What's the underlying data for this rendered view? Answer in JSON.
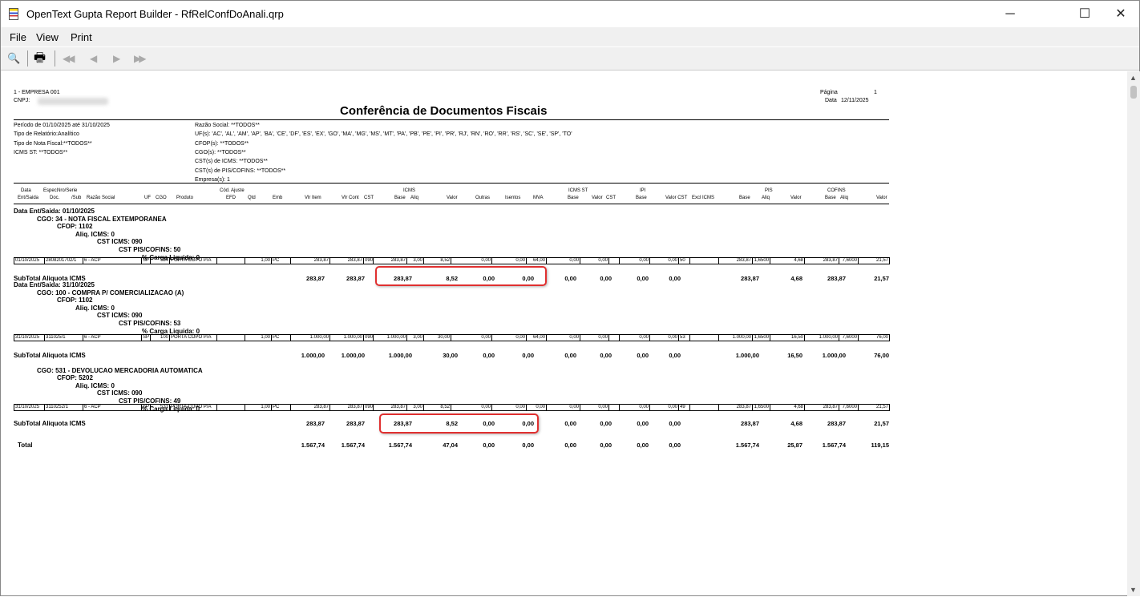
{
  "window": {
    "title": "OpenText Gupta Report Builder - RfRelConfDoAnali.qrp",
    "minimize": "─",
    "maximize": "☐",
    "close": "✕"
  },
  "menu": [
    "File",
    "View",
    "Print"
  ],
  "toolbar": {
    "icons": [
      "print-preview-icon",
      "printer-icon",
      "first-page-icon",
      "previous-page-icon",
      "next-page-icon",
      "last-page-icon"
    ],
    "glyphs": [
      "🔍",
      "🖶",
      "◀◀",
      "◀",
      "▶",
      "▶▶"
    ]
  },
  "report": {
    "company": "1 - EMPRESA 001",
    "cnpj_label": "CNPJ:",
    "page_label": "Página",
    "page": "1",
    "date_label": "Data",
    "date": "12/11/2025",
    "title": "Conferência de Documentos Fiscais",
    "filters_left": [
      "Período de 01/10/2025 até 31/10/2025",
      "Tipo de Relatório:Analítico",
      "Tipo de Nota Fiscal:**TODOS**",
      "ICMS ST: **TODOS**"
    ],
    "filters_right": [
      "Razão Social: **TODOS**",
      "UF(s): 'AC', 'AL', 'AM', 'AP', 'BA', 'CE', 'DF', 'ES', 'EX', 'GO', 'MA', 'MG', 'MS', 'MT', 'PA', 'PB', 'PE', 'PI', 'PR', 'RJ', 'RN', 'RO', 'RR', 'RS', 'SC', 'SE', 'SP', 'TO'",
      "CFOP(s): **TODOS**",
      "CGO(s): **TODOS**",
      "CST(s) de ICMS: **TODOS**",
      "CST(s) de PIS/COFINS: **TODOS**",
      "Empresa(s): 1"
    ],
    "column_groups": [
      "ICMS",
      "ICMS ST",
      "IPI",
      "PIS",
      "COFINS"
    ],
    "column_headers_top": [
      "Data",
      "Espec.",
      "Nro/Serie",
      "Cód. Ajuste"
    ],
    "column_headers": [
      "Ent/Saida",
      "Doc.",
      "/Sub",
      "Razão Social",
      "UF",
      "CGO",
      "Produto",
      "EFD",
      "Qtd",
      "Emb",
      "Vlr Item",
      "Vlr Cont",
      "CST",
      "Base",
      "Aliq",
      "Valor",
      "Outras",
      "Isentos",
      "MVA",
      "Base",
      "Valor",
      "CST",
      "Base",
      "Valor CST",
      "Excl ICMS",
      "Base",
      "Aliq",
      "Valor",
      "Base",
      "Aliq",
      "Valor"
    ],
    "groups": [
      {
        "date_header": "Data Ent/Saida: 01/10/2025",
        "cgo": "CGO: 34 - NOTA FISCAL EXTEMPORANEA",
        "cfop": "CFOP: 1102",
        "aliq": "Aliq. ICMS: 0",
        "cst_icms": "CST ICMS: 090",
        "cst_pis": "CST PIS/COFINS: 50",
        "carga": "% Carga Liquida: 0",
        "row": [
          "01/10/2025",
          "2808201702/1",
          "6 - ACP",
          "SP",
          "34",
          "PORTA COPO P/A",
          "",
          "1,00",
          "PC",
          "283,87",
          "283,87",
          "090",
          "283,87",
          "3,00",
          "8,52",
          "0,00",
          "0,00",
          "64,00",
          "0,00",
          "0,00",
          "",
          "0,00",
          "0,00",
          "50",
          "",
          "283,87",
          "1,6500",
          "4,68",
          "283,87",
          "7,6000",
          "21,57"
        ],
        "subtotal_label": "SubTotal Aliquota ICMS",
        "subtotal": [
          "283,87",
          "283,87",
          "283,87",
          "8,52",
          "0,00",
          "0,00",
          "0,00",
          "0,00",
          "0,00",
          "0,00",
          "283,87",
          "4,68",
          "283,87",
          "21,57"
        ]
      },
      {
        "date_header": "Data Ent/Saida: 31/10/2025",
        "cgo": "CGO: 100 - COMPRA P/ COMERCIALIZACAO (A)",
        "cfop": "CFOP: 1102",
        "aliq": "Aliq. ICMS: 0",
        "cst_icms": "CST ICMS: 090",
        "cst_pis": "CST PIS/COFINS: 53",
        "carga": "% Carga Liquida: 0",
        "row": [
          "31/10/2025",
          "311025/1",
          "6 - ACP",
          "SP",
          "100",
          "PORTA COPO P/A",
          "",
          "1,00",
          "PC",
          "1.000,00",
          "1.000,00",
          "090",
          "1.000,00",
          "3,00",
          "30,00",
          "0,00",
          "0,00",
          "64,00",
          "0,00",
          "0,00",
          "",
          "0,00",
          "0,00",
          "53",
          "",
          "1.000,00",
          "1,6500",
          "16,50",
          "1.000,00",
          "7,6000",
          "76,00"
        ],
        "subtotal_label": "SubTotal Aliquota ICMS",
        "subtotal": [
          "1.000,00",
          "1.000,00",
          "1.000,00",
          "30,00",
          "0,00",
          "0,00",
          "0,00",
          "0,00",
          "0,00",
          "0,00",
          "1.000,00",
          "16,50",
          "1.000,00",
          "76,00"
        ]
      },
      {
        "date_header": "",
        "cgo": "CGO: 531 - DEVOLUCAO MERCADORIA AUTOMATICA",
        "cfop": "CFOP: 5202",
        "aliq": "Aliq. ICMS: 0",
        "cst_icms": "CST ICMS: 090",
        "cst_pis": "CST PIS/COFINS: 49",
        "carga": "% Carga Liquida: 0",
        "row": [
          "31/10/2025",
          "3110252/1",
          "6 - ACP",
          "SP",
          "531",
          "PORTA COPO P/A",
          "",
          "1,00",
          "PC",
          "283,87",
          "283,87",
          "090",
          "283,87",
          "3,00",
          "8,52",
          "0,00",
          "0,00",
          "0,00",
          "0,00",
          "0,00",
          "",
          "0,00",
          "0,00",
          "49",
          "",
          "283,87",
          "1,6500",
          "4,68",
          "283,87",
          "7,6000",
          "21,57"
        ],
        "subtotal_label": "SubTotal Aliquota ICMS",
        "subtotal": [
          "283,87",
          "283,87",
          "283,87",
          "8,52",
          "0,00",
          "0,00",
          "0,00",
          "0,00",
          "0,00",
          "0,00",
          "283,87",
          "4,68",
          "283,87",
          "21,57"
        ]
      }
    ],
    "total_label": "Total",
    "total": [
      "1.567,74",
      "1.567,74",
      "1.567,74",
      "47,04",
      "0,00",
      "0,00",
      "0,00",
      "0,00",
      "0,00",
      "0,00",
      "1.567,74",
      "25,87",
      "1.567,74",
      "119,15"
    ]
  },
  "colors": {
    "highlight": "#e03030"
  }
}
